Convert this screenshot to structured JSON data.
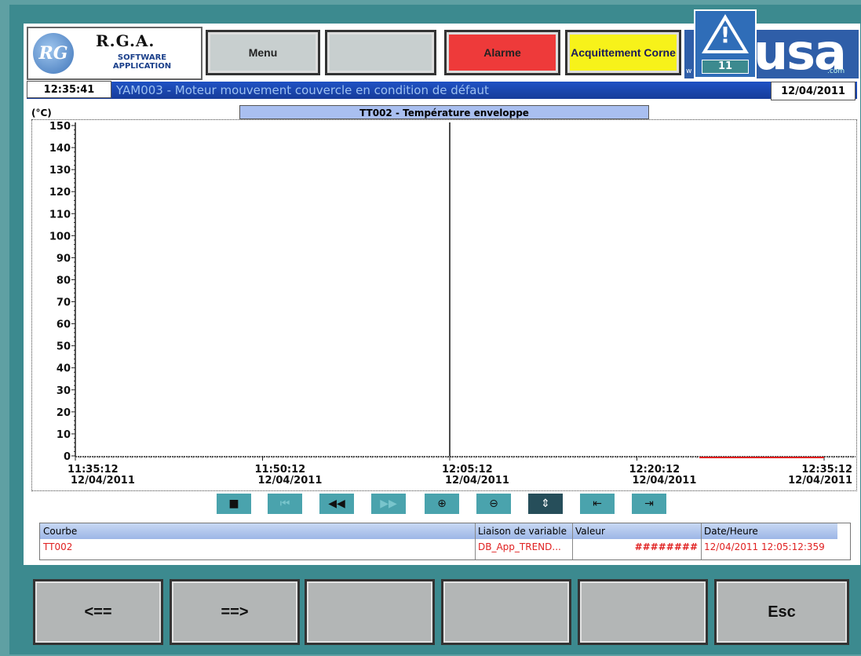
{
  "header": {
    "logo": {
      "mark": "RG",
      "title": "R.G.A.",
      "subtitle": "SOFTWARE APPLICATION"
    },
    "menu_label": "Menu",
    "blank_label": "",
    "alarm_label": "Alarme",
    "ack_label": "Acquittement Corne",
    "alert_count": "11",
    "brand": {
      "text": "usa",
      "prefix": "w",
      "suffix": ".com"
    }
  },
  "status": {
    "time": "12:35:41",
    "message": "YAM003 - Moteur mouvement couvercle en condition de défaut",
    "date": "12/04/2011"
  },
  "chart_data": {
    "type": "line",
    "title": "TT002 - Température enveloppe",
    "ylabel": "(°C)",
    "ylim": [
      0,
      150
    ],
    "yticks": [
      0,
      10,
      20,
      30,
      40,
      50,
      60,
      70,
      80,
      90,
      100,
      110,
      120,
      130,
      140,
      150
    ],
    "xticks": [
      {
        "time": "11:35:12",
        "date": "12/04/2011"
      },
      {
        "time": "11:50:12",
        "date": "12/04/2011"
      },
      {
        "time": "12:05:12",
        "date": "12/04/2011"
      },
      {
        "time": "12:20:12",
        "date": "12/04/2011"
      },
      {
        "time": "12:35:12",
        "date": "12/04/2011"
      }
    ],
    "cursor_time": "12:05:12",
    "series": [
      {
        "name": "TT002",
        "color": "#e02020",
        "points": [
          {
            "time": "12:25:12",
            "value": 0
          },
          {
            "time": "12:35:12",
            "value": 0
          }
        ]
      }
    ]
  },
  "toolbar": [
    "stop-icon",
    "first-icon",
    "rewind-icon",
    "forward-icon",
    "zoom-in-icon",
    "zoom-out-icon",
    "ruler-icon",
    "ruler-back-icon",
    "ruler-forward-icon"
  ],
  "table": {
    "headers": [
      "Courbe",
      "Liaison de variable",
      "Valeur",
      "Date/Heure"
    ],
    "rows": [
      [
        "TT002",
        "DB_App_TREND...",
        "########",
        "12/04/2011 12:05:12:359"
      ]
    ]
  },
  "footer": {
    "buttons": [
      "<==",
      "==>",
      "",
      "",
      "",
      "Esc"
    ]
  }
}
